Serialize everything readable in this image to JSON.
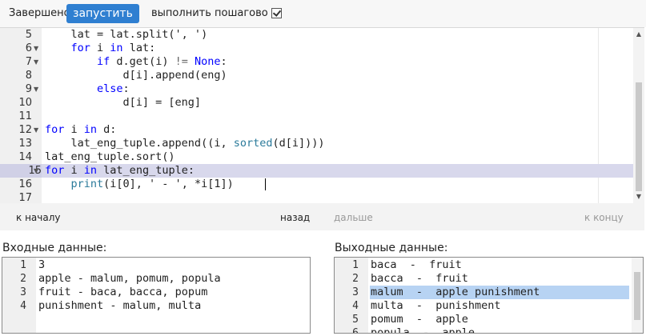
{
  "toolbar": {
    "status_text": "Завершено",
    "run_label": "запустить",
    "step_label": "выполнить пошагово",
    "step_checked": true
  },
  "editor": {
    "lines": [
      {
        "n": "5",
        "fold": false,
        "code": [
          [
            "    lat = lat.split(', ')",
            ""
          ]
        ]
      },
      {
        "n": "6",
        "fold": true,
        "code": [
          [
            "    ",
            ""
          ],
          [
            "for",
            "kw"
          ],
          [
            " i ",
            ""
          ],
          [
            "in",
            "kw"
          ],
          [
            " lat:",
            ""
          ]
        ]
      },
      {
        "n": "7",
        "fold": true,
        "code": [
          [
            "        ",
            ""
          ],
          [
            "if",
            "kw"
          ],
          [
            " d.get(i) ",
            ""
          ],
          [
            "!=",
            "cm"
          ],
          [
            " ",
            ""
          ],
          [
            "None",
            "kw"
          ],
          [
            ":",
            ""
          ]
        ]
      },
      {
        "n": "8",
        "fold": false,
        "code": [
          [
            "            d[i].append(eng)",
            ""
          ]
        ]
      },
      {
        "n": "9",
        "fold": true,
        "code": [
          [
            "        ",
            ""
          ],
          [
            "else",
            "kw"
          ],
          [
            ":",
            ""
          ]
        ]
      },
      {
        "n": "10",
        "fold": false,
        "code": [
          [
            "            d[i] = [eng]",
            ""
          ]
        ]
      },
      {
        "n": "11",
        "fold": false,
        "code": [
          [
            "",
            ""
          ]
        ]
      },
      {
        "n": "12",
        "fold": true,
        "code": [
          [
            "for",
            "kw"
          ],
          [
            " i ",
            ""
          ],
          [
            "in",
            "kw"
          ],
          [
            " d:",
            ""
          ]
        ]
      },
      {
        "n": "13",
        "fold": false,
        "code": [
          [
            "    lat_eng_tuple.append((i, ",
            ""
          ],
          [
            "sorted",
            "fn"
          ],
          [
            "(d[i])))",
            ""
          ]
        ]
      },
      {
        "n": "14",
        "fold": false,
        "code": [
          [
            "lat_eng_tuple.sort()",
            ""
          ]
        ]
      },
      {
        "n": "15",
        "fold": true,
        "active": true,
        "code": [
          [
            "for",
            "kw"
          ],
          [
            " i ",
            ""
          ],
          [
            "in",
            "kw"
          ],
          [
            " lat_eng_tuple:",
            ""
          ]
        ]
      },
      {
        "n": "16",
        "fold": false,
        "code": [
          [
            "    ",
            ""
          ],
          [
            "print",
            "fn"
          ],
          [
            "(i[0], ' - ', *i[1])",
            ""
          ]
        ]
      },
      {
        "n": "17",
        "fold": false,
        "code": [
          [
            "",
            ""
          ]
        ]
      }
    ]
  },
  "nav": {
    "start_label": "к началу",
    "back_label": "назад",
    "forward_label": "дальше",
    "end_label": "к концу"
  },
  "input": {
    "label": "Входные данные:",
    "lines": [
      {
        "n": "1",
        "text": "3"
      },
      {
        "n": "2",
        "text": "apple - malum, pomum, popula"
      },
      {
        "n": "3",
        "text": "fruit - baca, bacca, popum"
      },
      {
        "n": "4",
        "text": "punishment - malum, multa"
      }
    ]
  },
  "output": {
    "label": "Выходные данные:",
    "lines": [
      {
        "n": "1",
        "text": "baca  -  fruit"
      },
      {
        "n": "2",
        "text": "bacca  -  fruit"
      },
      {
        "n": "3",
        "text": "malum  -  apple punishment",
        "selected": true
      },
      {
        "n": "4",
        "text": "multa  -  punishment"
      },
      {
        "n": "5",
        "text": "pomum  -  apple"
      },
      {
        "n": "6",
        "text": "popula  -  apple"
      }
    ]
  }
}
